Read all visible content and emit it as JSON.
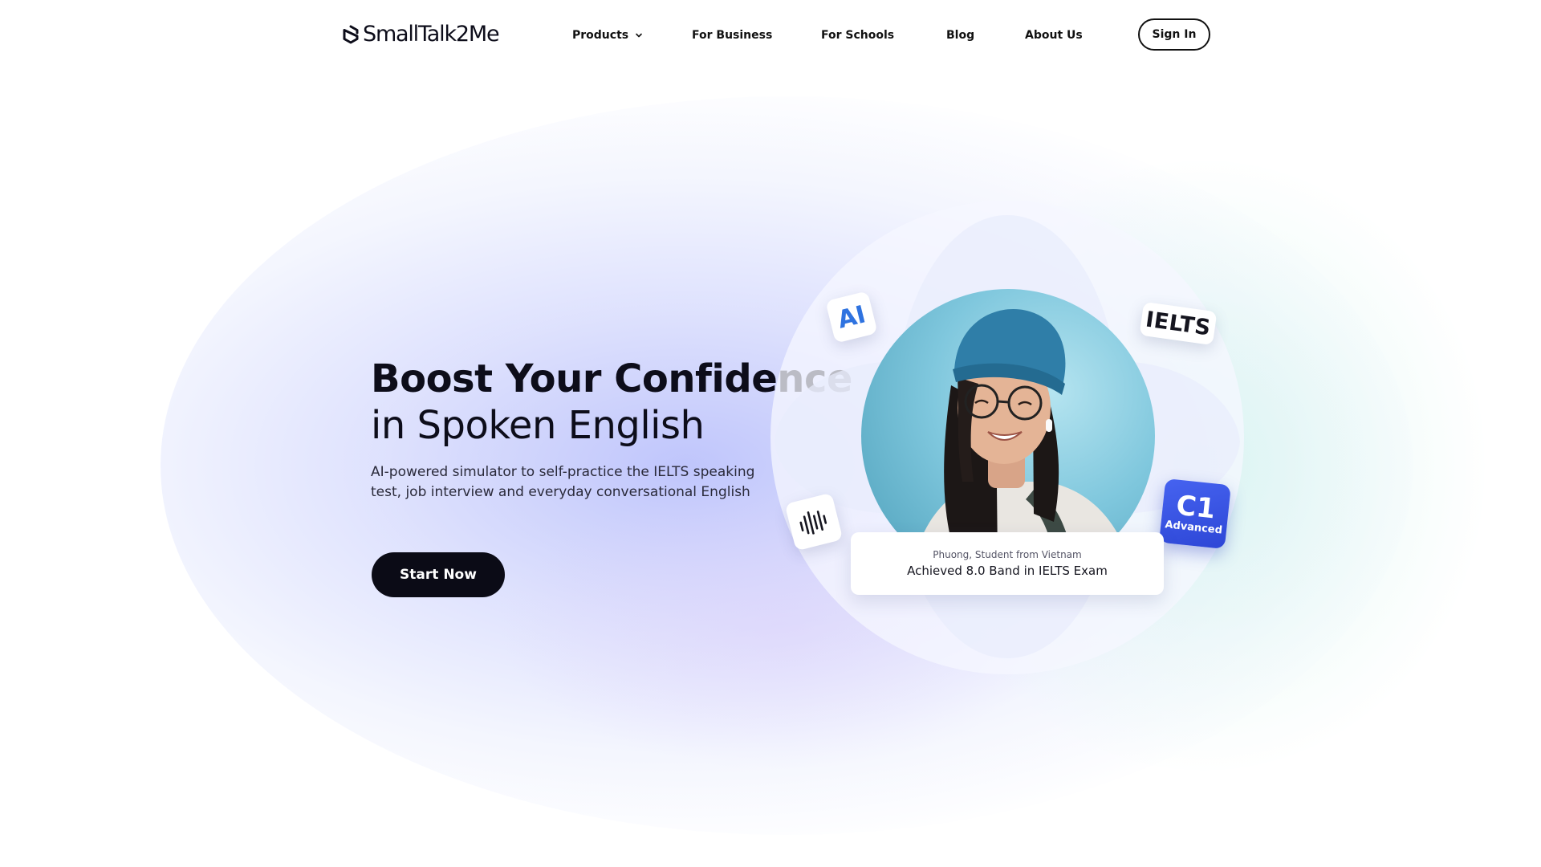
{
  "brand": {
    "logo_text": "SmallTalk2Me"
  },
  "nav": {
    "products_label": "Products",
    "business_label": "For Business",
    "schools_label": "For Schools",
    "blog_label": "Blog",
    "about_label": "About Us",
    "signin_label": "Sign In"
  },
  "hero": {
    "title_line1": "Boost Your Confidence",
    "title_line2": "in Spoken English",
    "subtitle": "AI-powered simulator to self-practice the IELTS speaking test, job interview and everyday conversational English",
    "cta_label": "Start Now"
  },
  "illustration": {
    "badge_ai": "AI",
    "badge_ielts": "IELTS",
    "badge_level": "C1",
    "badge_level_name": "Advanced",
    "caption_name": "Phuong, Student from Vietnam",
    "caption_achievement": "Achieved 8.0 Band in IELTS Exam"
  },
  "icons": {
    "logo_mark": "smalltalk2me-logo-icon",
    "products_chevron": "chevron-down-icon",
    "voice_badge": "sound-wave-icon",
    "portrait": "student-portrait"
  },
  "colors": {
    "primary_dark": "#0b0b16",
    "accent_blue": "#2f73e0",
    "level_badge": "#3a55e6",
    "glow_lavender": "#c4caf9",
    "glow_mint": "#d8f5ef"
  }
}
